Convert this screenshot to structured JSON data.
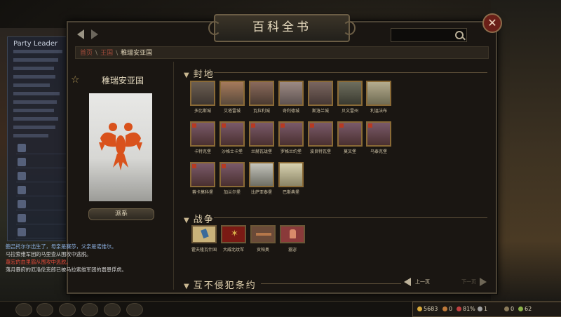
{
  "party_panel": {
    "title": "Party Leader",
    "buttons": [
      "",
      "",
      "",
      "",
      "",
      "",
      ""
    ]
  },
  "window": {
    "title": "百科全书",
    "close_glyph": "✕",
    "breadcrumb": {
      "home": "首页",
      "category": "王国",
      "current": "稚瑞安亚国"
    },
    "entity_name": "稚瑞安亚国",
    "lineage_button": "派系"
  },
  "fiefs": {
    "header": "封地",
    "tiles": [
      "多比斯城",
      "艾塔雷城",
      "瓦拉利城",
      "奇利德城",
      "斯洛兰城",
      "贝文雷州",
      "利温法布",
      "卡特克堡",
      "沙格士卡堡",
      "兰赫瓦珑堡",
      "罗格兰约堡",
      "波良特瓦堡",
      "莫叉堡",
      "乌泰克堡",
      "蓉卡莫科堡",
      "加兰尔堡",
      "比萨亚泰堡",
      "巴斯典堡"
    ]
  },
  "wars": {
    "header": "战争",
    "tiles": [
      "霍夫隆瓦什国",
      "大威北纹军",
      "贡帕奥",
      "嚣宓"
    ]
  },
  "treaties": {
    "header": "互不侵犯条约"
  },
  "pager": {
    "prev": "上一页",
    "next": "下一页"
  },
  "chat": [
    "鲍吕托尔尔出生了，母亲是赛莎，父亲是诺维尔。",
    "马拉索维军团的马里查从围攻中逃脱。",
    "蔑宏的血里霸从围攻中逃脱。",
    "落月暴府的厄洛伦克郎已被马拉索维军团的嚣恩俘虏。"
  ],
  "resources": {
    "gold": "5683",
    "influence": "0",
    "morale": "81%",
    "troops": "1",
    "prisoners": "0",
    "food": "62"
  },
  "colors": {
    "accent_gold": "#8a6a36",
    "war_red": "#b83a22",
    "chat_blue": "#8fb4e6",
    "chat_red": "#e24a3a"
  }
}
